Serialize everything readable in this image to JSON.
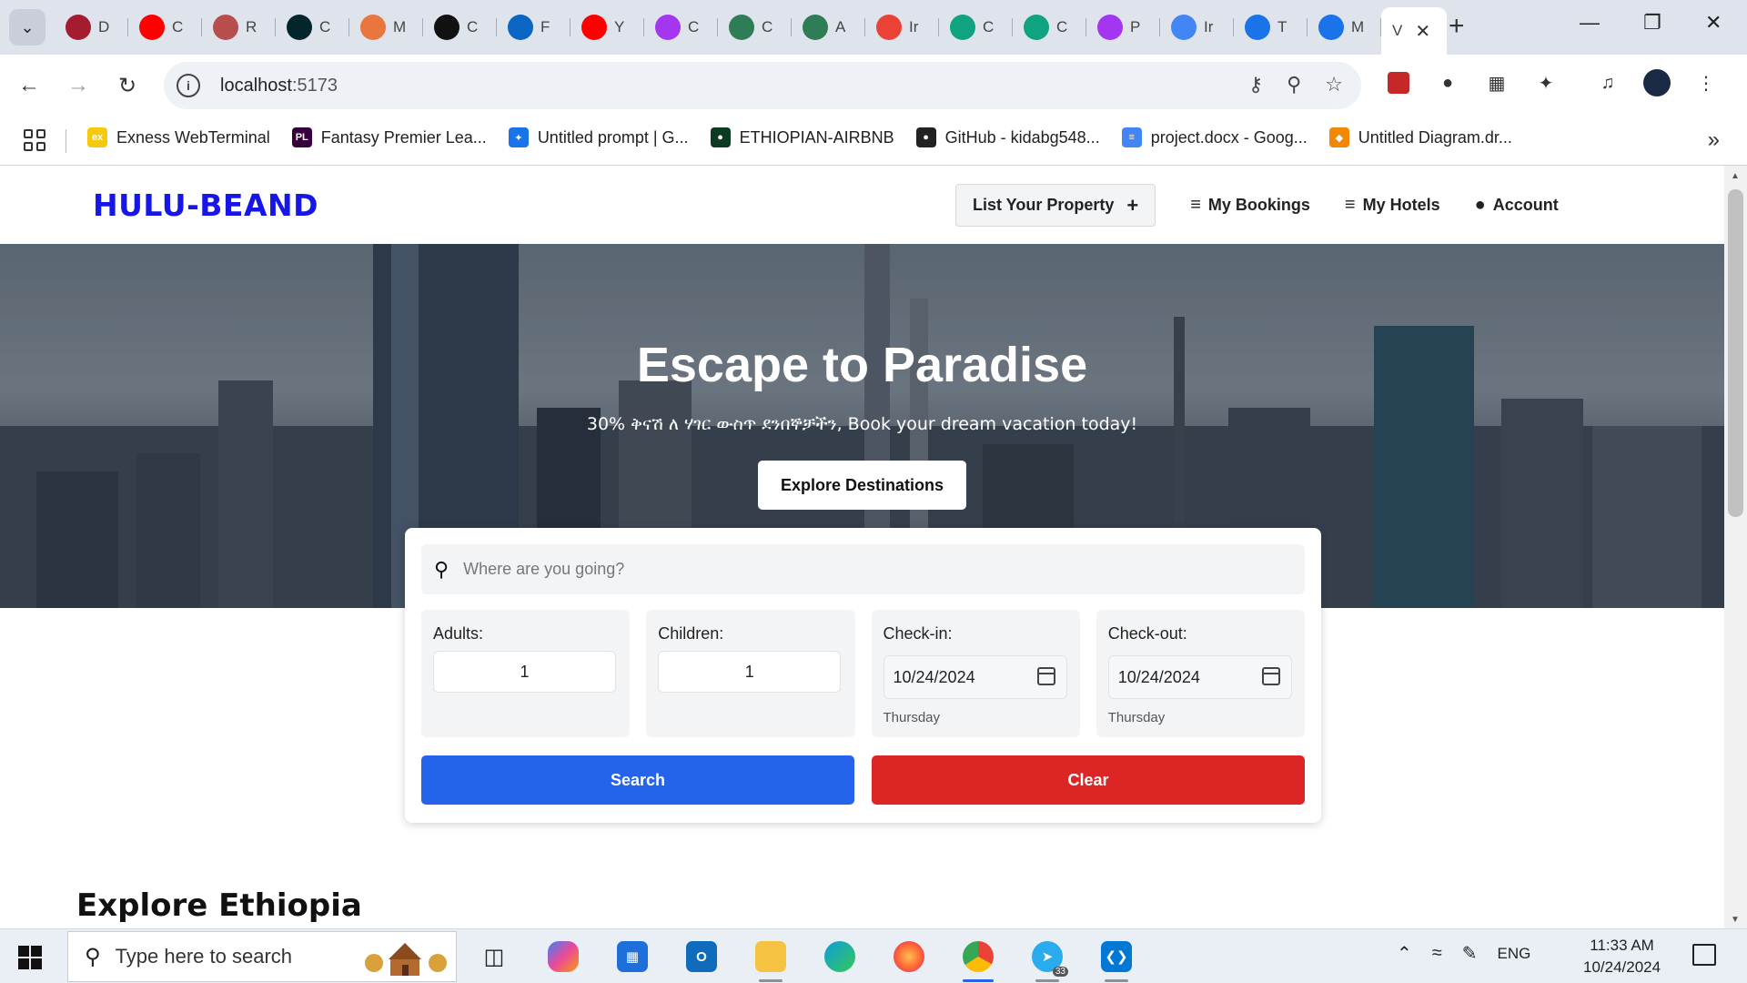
{
  "browser": {
    "tabs": [
      {
        "icon": "harvard-shield-icon",
        "label": "D",
        "color": "#a51c30"
      },
      {
        "icon": "youtube-icon",
        "label": "C",
        "color": "#ff0000"
      },
      {
        "icon": "avatar-icon",
        "label": "R",
        "color": "#b84d4d"
      },
      {
        "icon": "edx-icon",
        "label": "C",
        "color": "#02262b"
      },
      {
        "icon": "gl-icon",
        "label": "M",
        "color": "#e9763c"
      },
      {
        "icon": "chatgpt-icon",
        "label": "C",
        "color": "#111111"
      },
      {
        "icon": "linkedin-icon",
        "label": "F",
        "color": "#0a66c2"
      },
      {
        "icon": "youtube-icon",
        "label": "Y",
        "color": "#ff0000"
      },
      {
        "icon": "udemy-icon",
        "label": "C",
        "color": "#a435f0"
      },
      {
        "icon": "circle-logo-icon",
        "label": "C",
        "color": "#2e7d57"
      },
      {
        "icon": "circle-logo-icon",
        "label": "A",
        "color": "#2e7d57"
      },
      {
        "icon": "gmail-icon",
        "label": "Ir",
        "color": "#ea4335"
      },
      {
        "icon": "q-icon",
        "label": "C",
        "color": "#10a37f"
      },
      {
        "icon": "q-icon",
        "label": "C",
        "color": "#10a37f"
      },
      {
        "icon": "udemy-icon",
        "label": "P",
        "color": "#a435f0"
      },
      {
        "icon": "google-icon",
        "label": "Ir",
        "color": "#4285f4"
      },
      {
        "icon": "c-logo-icon",
        "label": "T",
        "color": "#1a73e8"
      },
      {
        "icon": "c-logo-icon",
        "label": "M",
        "color": "#1a73e8"
      }
    ],
    "active_tab_label": "V",
    "url_host": "localhost",
    "url_port": ":5173",
    "bookmarks": [
      {
        "icon": "exness-icon",
        "label": "Exness WebTerminal",
        "color": "#f6c90e",
        "glyph": "ex"
      },
      {
        "icon": "premier-league-icon",
        "label": "Fantasy Premier Lea...",
        "color": "#37003c",
        "glyph": "PL"
      },
      {
        "icon": "ai-studio-icon",
        "label": "Untitled prompt | G...",
        "color": "#1a73e8",
        "glyph": "✦"
      },
      {
        "icon": "mongodb-leaf-icon",
        "label": "ETHIOPIAN-AIRBNB",
        "color": "#0d3b22",
        "glyph": "●"
      },
      {
        "icon": "github-icon",
        "label": "GitHub - kidabg548...",
        "color": "#222222",
        "glyph": "●"
      },
      {
        "icon": "google-docs-icon",
        "label": "project.docx - Goog...",
        "color": "#4285f4",
        "glyph": "≡"
      },
      {
        "icon": "drawio-icon",
        "label": "Untitled Diagram.dr...",
        "color": "#f08705",
        "glyph": "◆"
      }
    ]
  },
  "site": {
    "logo": "HULU-BEAND",
    "nav": {
      "list_property": "List Your Property",
      "my_bookings": "My Bookings",
      "my_hotels": "My Hotels",
      "account": "Account"
    },
    "hero": {
      "title": "Escape to Paradise",
      "subtitle": "30% ቅናሽ ለ ሃገር ውስጥ ደንበኞቻችን, Book your dream vacation today!",
      "cta": "Explore Destinations"
    },
    "search": {
      "destination_placeholder": "Where are you going?",
      "adults_label": "Adults:",
      "adults_value": "1",
      "children_label": "Children:",
      "children_value": "1",
      "checkin_label": "Check-in:",
      "checkin_value": "10/24/2024",
      "checkin_day": "Thursday",
      "checkout_label": "Check-out:",
      "checkout_value": "10/24/2024",
      "checkout_day": "Thursday",
      "search_button": "Search",
      "clear_button": "Clear"
    },
    "section_title": "Explore Ethiopia"
  },
  "taskbar": {
    "search_placeholder": "Type here to search",
    "apps": [
      "task-view-icon",
      "copilot-icon",
      "microsoft-store-icon",
      "outlook-icon",
      "file-explorer-icon",
      "edge-icon",
      "firefox-icon",
      "chrome-icon",
      "telegram-icon",
      "vscode-icon"
    ],
    "telegram_badge": "33",
    "language": "ENG",
    "time": "11:33 AM",
    "date": "10/24/2024"
  },
  "colors": {
    "logo": "#1616e6",
    "search_button": "#2563eb",
    "clear_button": "#dc2626"
  }
}
